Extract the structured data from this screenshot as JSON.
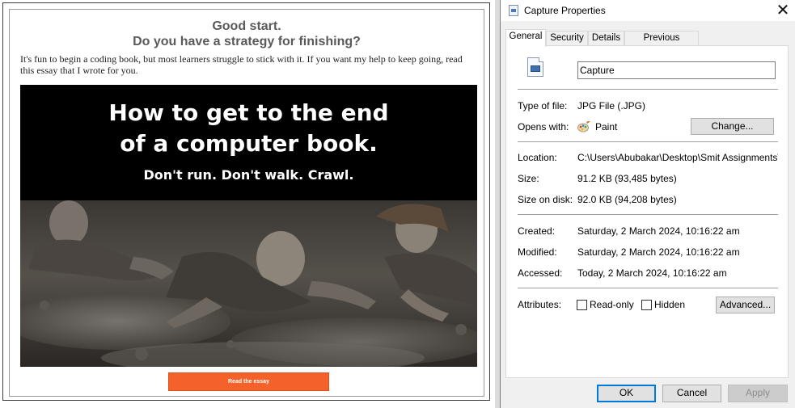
{
  "capture": {
    "heading_line1": "Good start.",
    "heading_line2": "Do you have a strategy for finishing?",
    "intro_text": "It's fun to begin a coding book, but most learners struggle to stick with it. If you want my help to keep going, read this essay that I wrote for you.",
    "banner_line1": "How to get to the end",
    "banner_line2": "of a computer book.",
    "banner_subtitle": "Don't run. Don't walk. Crawl.",
    "cta_label": "Read the essay",
    "cta_color": "#f4612b"
  },
  "dialog": {
    "title": "Capture Properties",
    "close_icon": "close-icon",
    "tabs": [
      {
        "label": "General",
        "active": true
      },
      {
        "label": "Security",
        "active": false
      },
      {
        "label": "Details",
        "active": false
      },
      {
        "label": "Previous Versions",
        "active": false
      }
    ],
    "file_name": "Capture",
    "type_label": "Type of file:",
    "type_value": "JPG File (.JPG)",
    "opens_label": "Opens with:",
    "opens_value": "Paint",
    "opens_icon": "paint-palette-icon",
    "change_button": "Change...",
    "location_label": "Location:",
    "location_value": "C:\\Users\\Abubakar\\Desktop\\Smit Assignments\\Ass",
    "size_label": "Size:",
    "size_value": "91.2 KB (93,485 bytes)",
    "size_on_disk_label": "Size on disk:",
    "size_on_disk_value": "92.0 KB (94,208 bytes)",
    "created_label": "Created:",
    "created_value": "Saturday, 2 March 2024, 10:16:22 am",
    "modified_label": "Modified:",
    "modified_value": "Saturday, 2 March 2024, 10:16:22 am",
    "accessed_label": "Accessed:",
    "accessed_value": "Today, 2 March 2024, 10:16:22 am",
    "attributes_label": "Attributes:",
    "readonly_label": "Read-only",
    "readonly_checked": false,
    "hidden_label": "Hidden",
    "hidden_checked": false,
    "advanced_button": "Advanced...",
    "ok_button": "OK",
    "cancel_button": "Cancel",
    "apply_button": "Apply",
    "accent_color": "#0078d7"
  }
}
